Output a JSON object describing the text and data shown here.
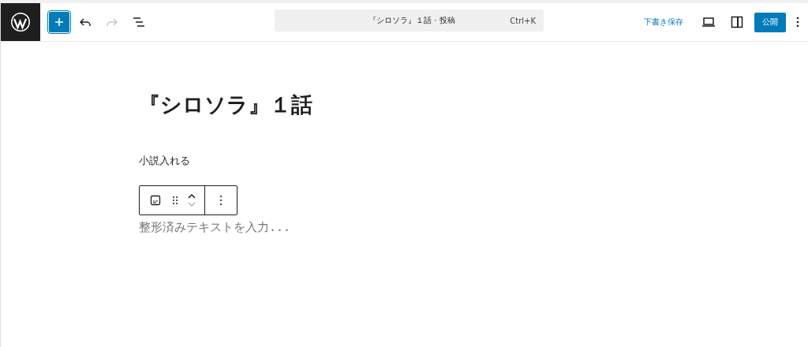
{
  "header": {
    "history": [
      {
        "kind": "undo",
        "disabled": false
      },
      {
        "kind": "redo",
        "disabled": true
      }
    ],
    "command_bar": {
      "title": "『シロソラ』１話 · 投稿",
      "shortcut": "Ctrl+K"
    },
    "save_draft": "下書き保存",
    "publish": "公開"
  },
  "editor": {
    "title": "『シロソラ』１話",
    "paragraph": "小説入れる",
    "preformatted_placeholder": "整形済みテキストを入力..."
  }
}
